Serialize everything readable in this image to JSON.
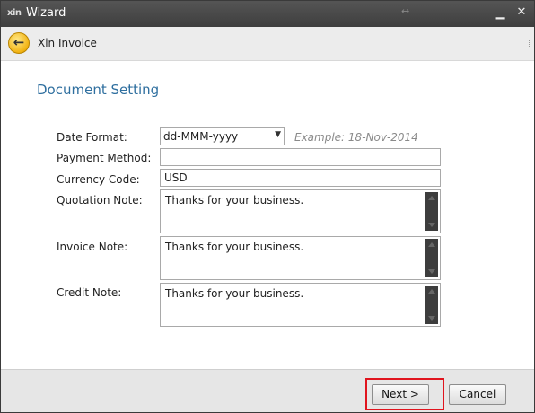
{
  "window": {
    "logo_text": "xin",
    "title": "Wizard",
    "resize_glyph": "↔",
    "minimize_glyph": "▁",
    "close_glyph": "✕"
  },
  "header": {
    "back_glyph": "←",
    "breadcrumb": "Xin Invoice"
  },
  "main": {
    "section_title": "Document Setting",
    "date_format": {
      "label": "Date Format:",
      "value": "dd-MMM-yyyy",
      "example": "Example: 18-Nov-2014"
    },
    "payment_method": {
      "label": "Payment Method:",
      "value": ""
    },
    "currency_code": {
      "label": "Currency Code:",
      "value": "USD"
    },
    "quotation_note": {
      "label": "Quotation Note:",
      "value": "Thanks for your business."
    },
    "invoice_note": {
      "label": "Invoice Note:",
      "value": "Thanks for your business."
    },
    "credit_note": {
      "label": "Credit Note:",
      "value": "Thanks for your business."
    }
  },
  "footer": {
    "next_label": "Next >",
    "cancel_label": "Cancel",
    "highlight_color": "#e0141e"
  },
  "icons": {
    "back": "back-arrow-icon",
    "dropdown": "chevron-down-icon",
    "scroll_up": "scroll-up-icon",
    "scroll_down": "scroll-down-icon"
  }
}
